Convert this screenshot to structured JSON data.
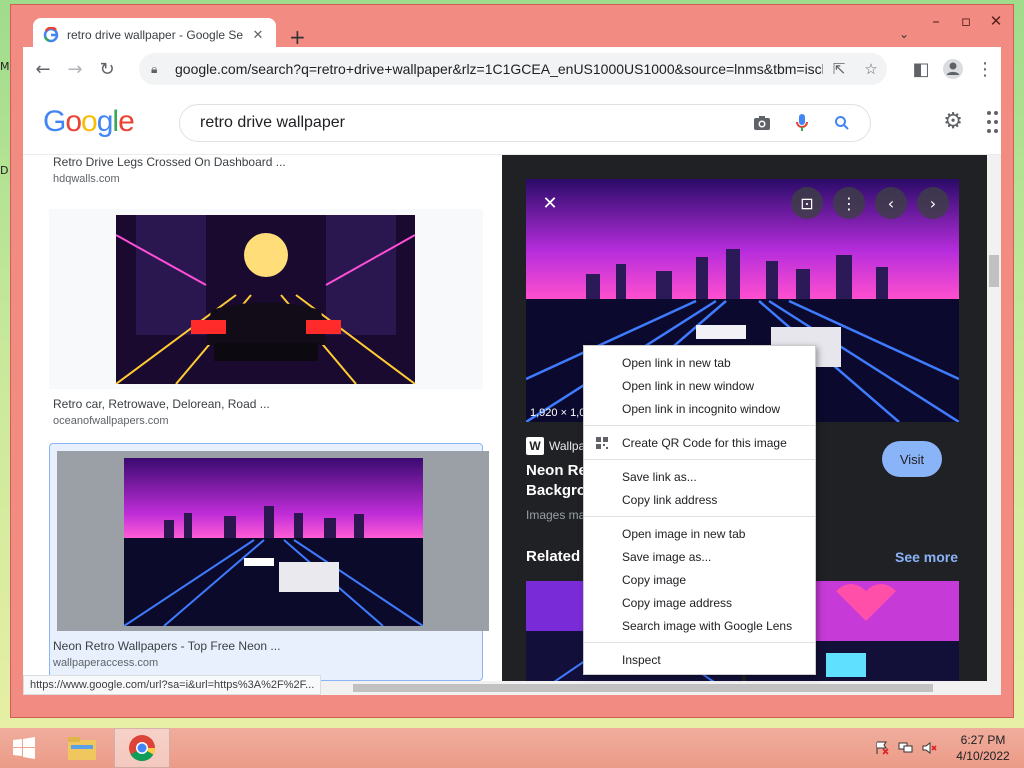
{
  "browser": {
    "tab_title": "retro drive wallpaper - Google Se",
    "url": "google.com/search?q=retro+drive+wallpaper&rlz=1C1GCEA_enUS1000US1000&source=lnms&tbm=isch..."
  },
  "search": {
    "logo": "Google",
    "query": "retro drive wallpaper"
  },
  "results": [
    {
      "title": "Retro Drive Legs Crossed On Dashboard ...",
      "source": "hdqwalls.com"
    },
    {
      "title": "Retro car, Retrowave, Delorean, Road ...",
      "source": "oceanofwallpapers.com"
    },
    {
      "title": "Neon Retro Wallpapers - Top Free Neon ...",
      "source": "wallpaperaccess.com"
    }
  ],
  "preview": {
    "dimensions": "1,920 × 1,080",
    "source": "Wallpape",
    "title_line1": "Neon Retro",
    "title_line2": "Backgroun",
    "note": "Images may",
    "visit_label": "Visit",
    "related_label": "Related im",
    "see_more_label": "See more"
  },
  "context_menu": {
    "items": [
      [
        "Open link in new tab",
        "Open link in new window",
        "Open link in incognito window"
      ],
      [
        "Create QR Code for this image"
      ],
      [
        "Save link as...",
        "Copy link address"
      ],
      [
        "Open image in new tab",
        "Save image as...",
        "Copy image",
        "Copy image address",
        "Search image with Google Lens"
      ],
      [
        "Inspect"
      ]
    ]
  },
  "status_url": "https://www.google.com/url?sa=i&url=https%3A%2F%2F...",
  "taskbar": {
    "time": "6:27 PM",
    "date": "4/10/2022"
  },
  "colors": {
    "window_frame": "#f28b82",
    "accent_blue": "#8ab4f8",
    "preview_bg": "#202124"
  }
}
